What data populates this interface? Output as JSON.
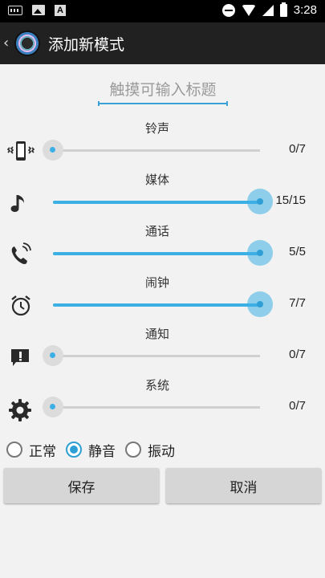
{
  "status_bar": {
    "time": "3:28",
    "left_icons": [
      "keyboard-icon",
      "image-icon",
      "a-icon"
    ],
    "right_icons": [
      "dnd-icon",
      "wifi-icon",
      "signal-icon",
      "battery-charging-icon"
    ]
  },
  "action_bar": {
    "title": "添加新模式",
    "back_icon": "chevron-left-icon",
    "logo_icon": "app-logo-icon"
  },
  "title_input": {
    "placeholder": "触摸可输入标题",
    "value": ""
  },
  "volumes": [
    {
      "label": "铃声",
      "icon": "phone-vibrate-icon",
      "value": 0,
      "max": 7,
      "display": "0/7"
    },
    {
      "label": "媒体",
      "icon": "music-note-icon",
      "value": 15,
      "max": 15,
      "display": "15/15"
    },
    {
      "label": "通话",
      "icon": "phone-call-icon",
      "value": 5,
      "max": 5,
      "display": "5/5"
    },
    {
      "label": "闹钟",
      "icon": "alarm-clock-icon",
      "value": 7,
      "max": 7,
      "display": "7/7"
    },
    {
      "label": "通知",
      "icon": "notification-icon",
      "value": 0,
      "max": 7,
      "display": "0/7"
    },
    {
      "label": "系统",
      "icon": "gear-icon",
      "value": 0,
      "max": 7,
      "display": "0/7"
    }
  ],
  "ringer_mode": {
    "options": [
      {
        "label": "正常",
        "checked": false
      },
      {
        "label": "静音",
        "checked": true
      },
      {
        "label": "振动",
        "checked": false
      }
    ]
  },
  "buttons": {
    "save_label": "保存",
    "cancel_label": "取消"
  },
  "colors": {
    "accent": "#3cb0e4",
    "action_bar": "#212121",
    "background": "#f2f2f2"
  }
}
